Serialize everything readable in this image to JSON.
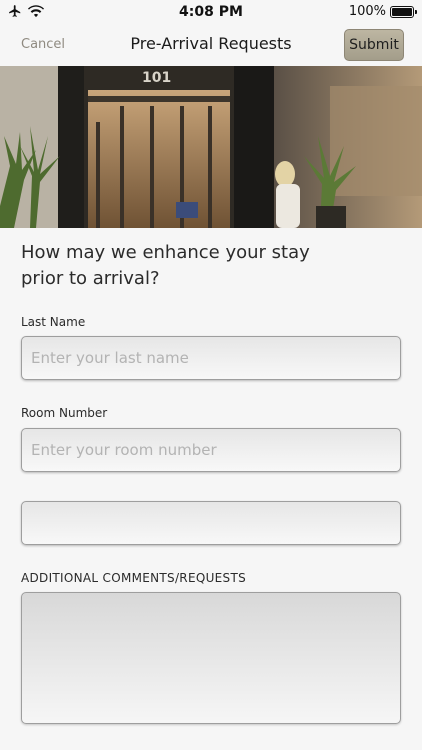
{
  "status_bar": {
    "time": "4:08 PM",
    "battery_percent": "100%",
    "icons": [
      "airplane-icon",
      "wifi-icon",
      "battery-icon"
    ]
  },
  "nav": {
    "cancel_label": "Cancel",
    "title": "Pre-Arrival Requests",
    "submit_label": "Submit"
  },
  "hero": {
    "building_number": "101"
  },
  "form": {
    "headline": "How may we enhance your stay prior to arrival?",
    "last_name": {
      "label": "Last Name",
      "placeholder": "Enter your last name",
      "value": ""
    },
    "room_number": {
      "label": "Room Number",
      "placeholder": "Enter your room number",
      "value": ""
    },
    "extra_field": {
      "value": ""
    },
    "comments": {
      "label": "ADDITIONAL COMMENTS/REQUESTS",
      "value": ""
    }
  },
  "colors": {
    "background": "#f6f6f6",
    "submit_button": "#aea895",
    "cancel_text": "#8f8a80"
  }
}
